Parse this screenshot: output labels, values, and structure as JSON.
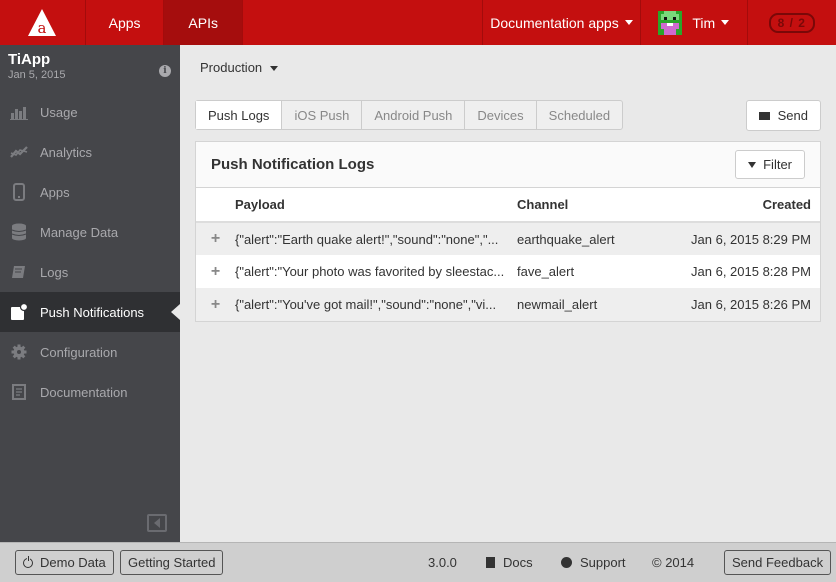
{
  "topbar": {
    "nav": [
      {
        "label": "Apps"
      },
      {
        "label": "APIs"
      }
    ],
    "doc_apps_label": "Documentation apps",
    "user_name": "Tim",
    "counter": "8 / 2"
  },
  "sidebar": {
    "app_name": "TiApp",
    "app_date": "Jan 5, 2015",
    "items": [
      {
        "label": "Usage",
        "icon": "bar-chart-icon"
      },
      {
        "label": "Analytics",
        "icon": "line-chart-icon"
      },
      {
        "label": "Apps",
        "icon": "mobile-icon"
      },
      {
        "label": "Manage Data",
        "icon": "database-icon"
      },
      {
        "label": "Logs",
        "icon": "book-icon"
      },
      {
        "label": "Push Notifications",
        "icon": "notification-icon"
      },
      {
        "label": "Configuration",
        "icon": "gear-icon"
      },
      {
        "label": "Documentation",
        "icon": "document-icon"
      }
    ]
  },
  "main": {
    "environment": "Production",
    "tabs": [
      {
        "label": "Push Logs"
      },
      {
        "label": "iOS Push"
      },
      {
        "label": "Android Push"
      },
      {
        "label": "Devices"
      },
      {
        "label": "Scheduled"
      }
    ],
    "send_label": "Send",
    "panel_title": "Push Notification Logs",
    "filter_label": "Filter",
    "columns": {
      "payload": "Payload",
      "channel": "Channel",
      "created": "Created"
    },
    "rows": [
      {
        "payload": "{\"alert\":\"Earth quake alert!\",\"sound\":\"none\",\"...",
        "channel": "earthquake_alert",
        "created": "Jan 6, 2015 8:29 PM"
      },
      {
        "payload": "{\"alert\":\"Your photo was favorited by sleestac...",
        "channel": "fave_alert",
        "created": "Jan 6, 2015 8:28 PM"
      },
      {
        "payload": "{\"alert\":\"You've got mail!\",\"sound\":\"none\",\"vi...",
        "channel": "newmail_alert",
        "created": "Jan 6, 2015 8:26 PM"
      }
    ]
  },
  "footer": {
    "demo_data": "Demo Data",
    "getting_started": "Getting Started",
    "version": "3.0.0",
    "docs": "Docs",
    "support": "Support",
    "copyright": "© 2014",
    "send_feedback": "Send Feedback"
  },
  "colors": {
    "brand_red": "#c40f0f",
    "sidebar_bg": "#45464a",
    "sidebar_active": "#2f3033"
  }
}
